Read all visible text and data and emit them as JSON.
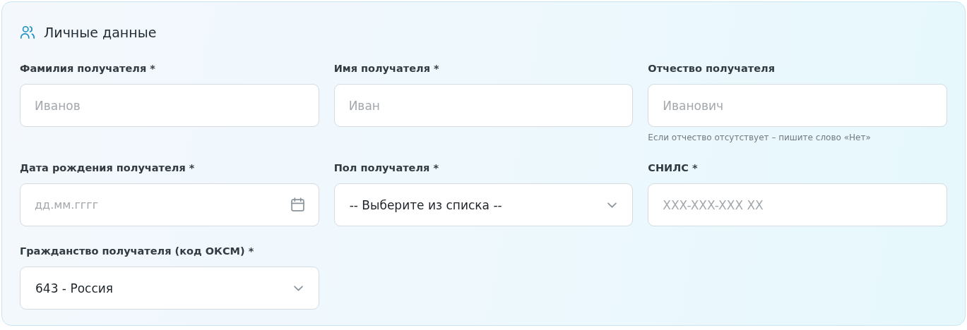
{
  "section": {
    "title": "Личные данные"
  },
  "fields": [
    {
      "kind": "text",
      "label": "Фамилия получателя *",
      "placeholder": "Иванов"
    },
    {
      "kind": "text",
      "label": "Имя получателя *",
      "placeholder": "Иван"
    },
    {
      "kind": "text",
      "label": "Отчество получателя",
      "placeholder": "Иванович",
      "hint": "Если отчество отсутствует – пишите слово «Нет»"
    },
    {
      "kind": "date",
      "label": "Дата рождения получателя *",
      "placeholder": "дд.мм.гггг"
    },
    {
      "kind": "select",
      "label": "Пол получателя *",
      "value": "-- Выберите из списка --"
    },
    {
      "kind": "text",
      "label": "СНИЛС *",
      "placeholder": "XXX-XXX-XXX XX"
    },
    {
      "kind": "select",
      "label": "Гражданство получателя (код ОКСМ) *",
      "value": "643 - Россия"
    }
  ]
}
